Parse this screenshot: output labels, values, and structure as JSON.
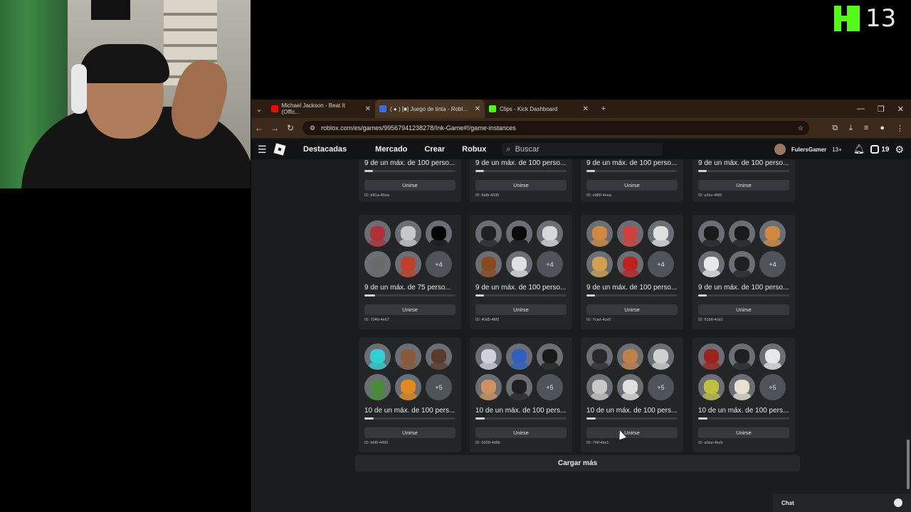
{
  "overlay": {
    "kick_count": "13",
    "kick_color": "#53fc18"
  },
  "browser": {
    "tabs": [
      {
        "label": "Michael Jackson - Beat It (Offic...",
        "icon": "youtube-icon",
        "color": "#ff0000",
        "active": false
      },
      {
        "label": "( ● ) [■] Juego de tinta - Robl...",
        "icon": "roblox-icon",
        "color": "#3b6fd8",
        "active": true
      },
      {
        "label": "Clips - Kick Dashboard",
        "icon": "kick-icon",
        "color": "#53fc18",
        "active": false
      }
    ],
    "new_tab_label": "+",
    "url": "roblox.com/es/games/99567941238278/Ink-Game#!/game-instances"
  },
  "site_nav": {
    "items": [
      "Destacadas",
      "Mercado",
      "Crear",
      "Robux"
    ],
    "search_placeholder": "Buscar",
    "username": "FulersGamer",
    "age_badge": "13+",
    "robux_count": "19"
  },
  "servers_top_row": [
    {
      "status": "9 de un máx. de 100 perso...",
      "fill": 0.09,
      "join": "Unirse",
      "id": "ID: b81a-45ea"
    },
    {
      "status": "9 de un máx. de 100 perso...",
      "fill": 0.09,
      "join": "Unirse",
      "id": "ID: 8afb-4335"
    },
    {
      "status": "9 de un máx. de 100 perso...",
      "fill": 0.09,
      "join": "Unirse",
      "id": "ID: e980-4eea"
    },
    {
      "status": "9 de un máx. de 100 perso...",
      "fill": 0.09,
      "join": "Unirse",
      "id": "ID: a3ce-4fd9"
    }
  ],
  "servers": [
    {
      "more": "+4",
      "status": "9 de un máx. de 75 perso...",
      "fill": 0.12,
      "join": "Unirse",
      "id": "ID: 704b-4e67",
      "avatars": [
        "#b0303a",
        "#c8c8c8",
        "#050505",
        "#6a6a6a",
        "#c0402a"
      ]
    },
    {
      "more": "+4",
      "status": "9 de un máx. de 100 perso...",
      "fill": 0.09,
      "join": "Unirse",
      "id": "ID: 40d5-48f2",
      "avatars": [
        "#202020",
        "#0b0b0b",
        "#d8d8d8",
        "#8a4a20",
        "#e0e0e0"
      ]
    },
    {
      "more": "+4",
      "status": "9 de un máx. de 100 perso...",
      "fill": 0.09,
      "join": "Unirse",
      "id": "ID: 7cad-4ce0",
      "avatars": [
        "#d08a40",
        "#d04040",
        "#e0e0e0",
        "#d0a050",
        "#c02020"
      ]
    },
    {
      "more": "+4",
      "status": "9 de un máx. de 100 perso...",
      "fill": 0.09,
      "join": "Unirse",
      "id": "ID: 91b8-4cb2",
      "avatars": [
        "#1a1a1a",
        "#1a1a1a",
        "#d08a40",
        "#e8e8e8",
        "#202020"
      ]
    },
    {
      "more": "+5",
      "status": "10 de un máx. de 100 pers...",
      "fill": 0.1,
      "join": "Unirse",
      "id": "ID: b6f5-4490",
      "avatars": [
        "#30d0d0",
        "#8a5a3a",
        "#5a3a2a",
        "#4a8a3a",
        "#e08a20"
      ]
    },
    {
      "more": "+5",
      "status": "10 de un máx. de 100 pers...",
      "fill": 0.1,
      "join": "Unirse",
      "id": "ID: 6028-4d5b",
      "avatars": [
        "#d0d0e0",
        "#3060c0",
        "#1a1a1a",
        "#d09060",
        "#202020"
      ]
    },
    {
      "more": "+5",
      "status": "10 de un máx. de 100 pers...",
      "fill": 0.1,
      "join": "Unirse",
      "id": "ID: 7f4f-4bc1",
      "avatars": [
        "#2a2a2a",
        "#c0804a",
        "#d0d0d0",
        "#c8c8c8",
        "#e0e0e0"
      ]
    },
    {
      "more": "+5",
      "status": "10 de un máx. de 100 pers...",
      "fill": 0.1,
      "join": "Unirse",
      "id": "ID: a0ae-4bcb",
      "avatars": [
        "#a02020",
        "#202020",
        "#e8e8e8",
        "#c0c040",
        "#e8e0d0"
      ]
    }
  ],
  "load_more_label": "Cargar más",
  "chat_label": "Chat"
}
